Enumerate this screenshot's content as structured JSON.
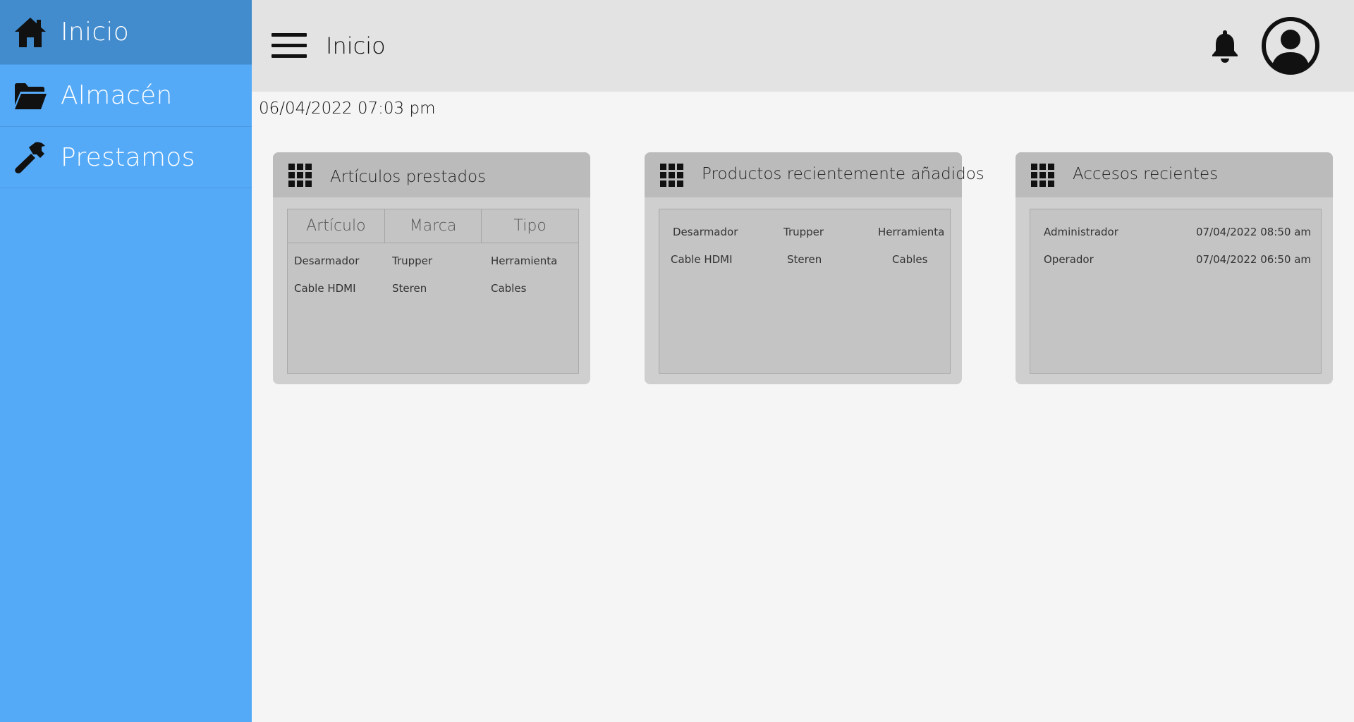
{
  "sidebar": {
    "items": [
      {
        "label": "Inicio",
        "icon": "home-icon",
        "active": true
      },
      {
        "label": "Almacén",
        "icon": "folder-icon",
        "active": false
      },
      {
        "label": "Prestamos",
        "icon": "hammer-icon",
        "active": false
      }
    ]
  },
  "header": {
    "title": "Inicio",
    "menu_icon": "hamburger-menu-icon",
    "notification_icon": "bell-icon",
    "account_icon": "user-account-icon"
  },
  "datetime": "06/04/2022 07:03 pm",
  "cards": [
    {
      "title": "Artículos prestados",
      "icon": "grid-icon",
      "columns": [
        "Artículo",
        "Marca",
        "Tipo"
      ],
      "rows": [
        [
          "Desarmador",
          "Trupper",
          "Herramienta"
        ],
        [
          "Cable HDMI",
          "Steren",
          "Cables"
        ]
      ]
    },
    {
      "title": "Productos recientemente añadidos",
      "icon": "grid-icon",
      "rows": [
        [
          "Desarmador",
          "Trupper",
          "Herramienta"
        ],
        [
          "Cable HDMI",
          "Steren",
          "Cables"
        ]
      ]
    },
    {
      "title": "Accesos recientes",
      "icon": "grid-icon",
      "rows": [
        [
          "Administrador",
          "07/04/2022 08:50 am"
        ],
        [
          "Operador",
          "07/04/2022 06:50 am"
        ]
      ]
    }
  ],
  "colors": {
    "sidebar_bg": "#55aaf8",
    "sidebar_active": "#428bcd",
    "topbar_bg": "#e3e3e3",
    "page_bg": "#f5f5f5",
    "card_bg": "#cfcfcf",
    "card_header": "#bbbbbb"
  }
}
